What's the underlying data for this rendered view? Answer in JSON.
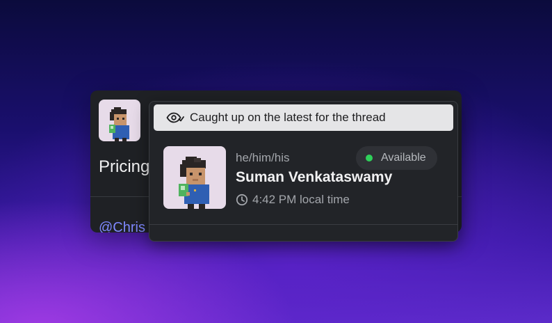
{
  "background_card": {
    "title": "Pricing",
    "mention": "@Chris"
  },
  "popover": {
    "banner": {
      "icon": "eye-check-icon",
      "text": "Caught up on the latest for the thread"
    },
    "profile": {
      "pronouns": "he/him/his",
      "name": "Suman Venkataswamy",
      "status": {
        "label": "Available",
        "color": "#2fd05a"
      },
      "local_time": "4:42 PM local time",
      "time_icon": "clock-icon"
    }
  },
  "colors": {
    "card_bg": "#1f2125",
    "popover_bg": "#222428",
    "banner_bg": "#e5e5e7",
    "mention": "#7f88ff"
  }
}
